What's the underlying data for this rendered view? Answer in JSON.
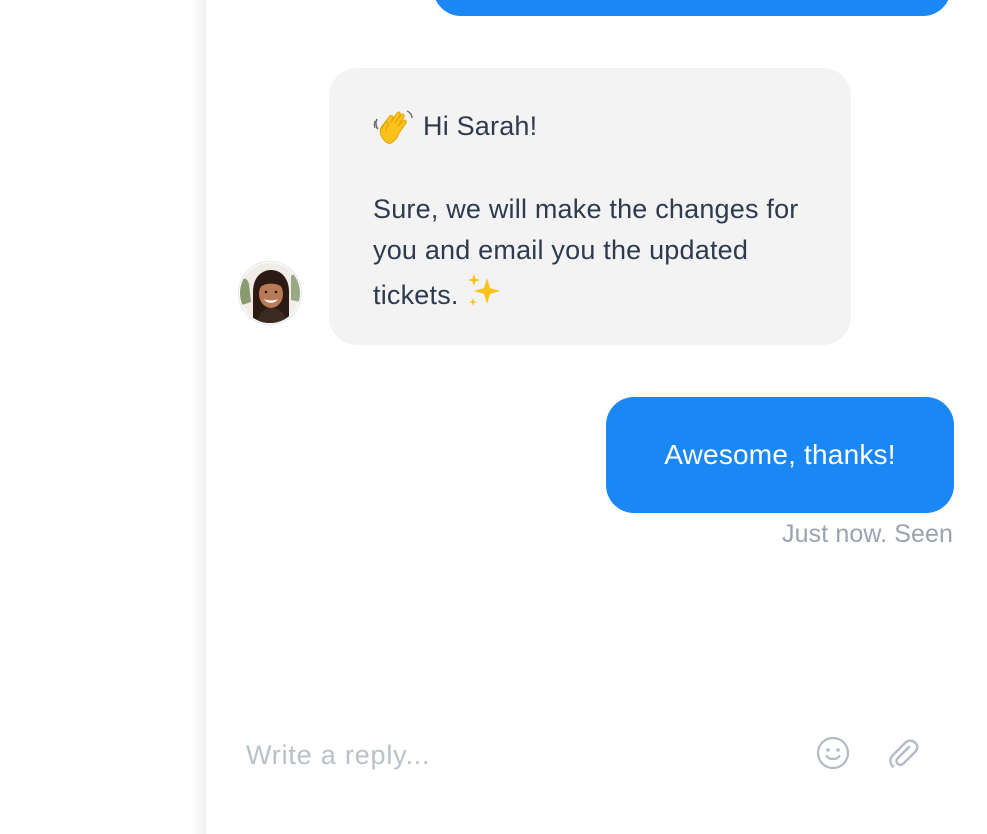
{
  "conversation": {
    "messages": [
      {
        "from": "admin",
        "greeting": "Hi Sarah!",
        "body": "Sure, we will make the changes for you and email you the updated tickets.",
        "avatar_icon": "admin-avatar",
        "emojis": [
          "waving-hand-icon",
          "sparkles-icon"
        ]
      },
      {
        "from": "user",
        "text": "Awesome, thanks!",
        "status": "Just now. Seen"
      }
    ]
  },
  "composer": {
    "placeholder": "Write a reply...",
    "emoji_icon": "smiley-icon",
    "attach_icon": "paperclip-icon"
  },
  "colors": {
    "user_bubble": "#1a87f5",
    "admin_bubble": "#f3f3f3",
    "admin_text": "#2e3a4e",
    "muted_text": "#9aa3ae",
    "placeholder": "#b9c1ca"
  }
}
